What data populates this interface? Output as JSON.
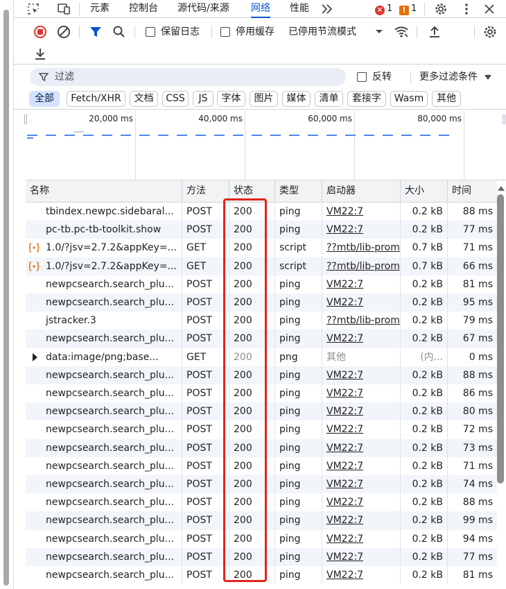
{
  "tabs": [
    {
      "label": "元素"
    },
    {
      "label": "控制台"
    },
    {
      "label": "源代码/来源"
    },
    {
      "label": "网络",
      "active": true
    },
    {
      "label": "性能"
    }
  ],
  "badges": {
    "errors": "1",
    "warnings": "1"
  },
  "toolbar": {
    "preserve_log": "保留日志",
    "disable_cache": "停用缓存",
    "throttling": "已停用节流模式"
  },
  "filter": {
    "placeholder": "过滤",
    "invert": "反转",
    "more_filters": "更多过滤条件"
  },
  "type_filters": [
    "全部",
    "Fetch/XHR",
    "文档",
    "CSS",
    "JS",
    "字体",
    "图片",
    "媒体",
    "清单",
    "套接字",
    "Wasm",
    "其他"
  ],
  "overview": {
    "ticks": [
      "20,000 ms",
      "40,000 ms",
      "60,000 ms",
      "80,000 ms"
    ]
  },
  "columns": [
    "名称",
    "方法",
    "状态",
    "类型",
    "启动器",
    "大小",
    "时间"
  ],
  "rows": [
    {
      "name": "tbindex.newpc.sidebaral...",
      "method": "POST",
      "status": "200",
      "type": "ping",
      "initiator": "VM22:7",
      "size": "0.2 kB",
      "time": "88 ms",
      "icon": "none"
    },
    {
      "name": "pc-tb.pc-tb-toolkit.show",
      "method": "POST",
      "status": "200",
      "type": "ping",
      "initiator": "VM22:7",
      "size": "0.2 kB",
      "time": "77 ms",
      "icon": "none"
    },
    {
      "name": "1.0/?jsv=2.7.2&appKey=...",
      "method": "GET",
      "status": "200",
      "type": "script",
      "initiator": "??mtb/lib-prom",
      "size": "0.7 kB",
      "time": "71 ms",
      "icon": "script"
    },
    {
      "name": "1.0/?jsv=2.7.2&appKey=...",
      "method": "GET",
      "status": "200",
      "type": "script",
      "initiator": "??mtb/lib-prom",
      "size": "0.7 kB",
      "time": "66 ms",
      "icon": "script"
    },
    {
      "name": "newpcsearch.search_plu...",
      "method": "POST",
      "status": "200",
      "type": "ping",
      "initiator": "VM22:7",
      "size": "0.2 kB",
      "time": "81 ms",
      "icon": "none"
    },
    {
      "name": "newpcsearch.search_plu...",
      "method": "POST",
      "status": "200",
      "type": "ping",
      "initiator": "VM22:7",
      "size": "0.2 kB",
      "time": "95 ms",
      "icon": "none"
    },
    {
      "name": "jstracker.3",
      "method": "POST",
      "status": "200",
      "type": "ping",
      "initiator": "??mtb/lib-prom",
      "size": "0.2 kB",
      "time": "79 ms",
      "icon": "none"
    },
    {
      "name": "newpcsearch.search_plu...",
      "method": "POST",
      "status": "200",
      "type": "ping",
      "initiator": "VM22:7",
      "size": "0.2 kB",
      "time": "67 ms",
      "icon": "none"
    },
    {
      "name": "data:image/png;base...",
      "method": "GET",
      "status": "200",
      "type": "png",
      "initiator": "其他",
      "size": "(内...",
      "time": "0 ms",
      "icon": "expand",
      "muted": true
    },
    {
      "name": "newpcsearch.search_plu...",
      "method": "POST",
      "status": "200",
      "type": "ping",
      "initiator": "VM22:7",
      "size": "0.2 kB",
      "time": "88 ms",
      "icon": "none"
    },
    {
      "name": "newpcsearch.search_plu...",
      "method": "POST",
      "status": "200",
      "type": "ping",
      "initiator": "VM22:7",
      "size": "0.2 kB",
      "time": "86 ms",
      "icon": "none"
    },
    {
      "name": "newpcsearch.search_plu...",
      "method": "POST",
      "status": "200",
      "type": "ping",
      "initiator": "VM22:7",
      "size": "0.2 kB",
      "time": "80 ms",
      "icon": "none"
    },
    {
      "name": "newpcsearch.search_plu...",
      "method": "POST",
      "status": "200",
      "type": "ping",
      "initiator": "VM22:7",
      "size": "0.2 kB",
      "time": "72 ms",
      "icon": "none"
    },
    {
      "name": "newpcsearch.search_plu...",
      "method": "POST",
      "status": "200",
      "type": "ping",
      "initiator": "VM22:7",
      "size": "0.2 kB",
      "time": "73 ms",
      "icon": "none"
    },
    {
      "name": "newpcsearch.search_plu...",
      "method": "POST",
      "status": "200",
      "type": "ping",
      "initiator": "VM22:7",
      "size": "0.2 kB",
      "time": "71 ms",
      "icon": "none"
    },
    {
      "name": "newpcsearch.search_plu...",
      "method": "POST",
      "status": "200",
      "type": "ping",
      "initiator": "VM22:7",
      "size": "0.2 kB",
      "time": "74 ms",
      "icon": "none"
    },
    {
      "name": "newpcsearch.search_plu...",
      "method": "POST",
      "status": "200",
      "type": "ping",
      "initiator": "VM22:7",
      "size": "0.2 kB",
      "time": "88 ms",
      "icon": "none"
    },
    {
      "name": "newpcsearch.search_plu...",
      "method": "POST",
      "status": "200",
      "type": "ping",
      "initiator": "VM22:7",
      "size": "0.2 kB",
      "time": "99 ms",
      "icon": "none"
    },
    {
      "name": "newpcsearch.search_plu...",
      "method": "POST",
      "status": "200",
      "type": "ping",
      "initiator": "VM22:7",
      "size": "0.2 kB",
      "time": "94 ms",
      "icon": "none"
    },
    {
      "name": "newpcsearch.search_plu...",
      "method": "POST",
      "status": "200",
      "type": "ping",
      "initiator": "VM22:7",
      "size": "0.2 kB",
      "time": "77 ms",
      "icon": "none"
    },
    {
      "name": "newpcsearch.search_plu...",
      "method": "POST",
      "status": "200",
      "type": "ping",
      "initiator": "VM22:7",
      "size": "0.2 kB",
      "time": "81 ms",
      "icon": "none"
    }
  ],
  "colors": {
    "accent": "#0b57d0",
    "highlight": "#e3241b",
    "error": "#dc362e",
    "warning": "#e8710a"
  }
}
